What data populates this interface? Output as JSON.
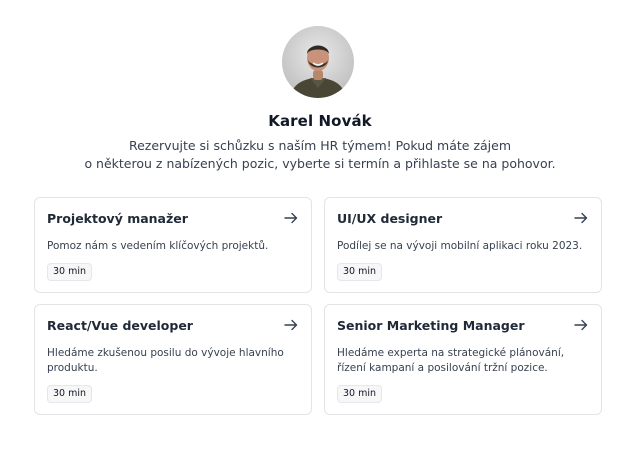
{
  "profile": {
    "name": "Karel Novák",
    "intro_line1": "Rezervujte si schůzku s naším HR týmem! Pokud máte zájem",
    "intro_line2": "o některou z nabízených pozic, vyberte si termín a přihlaste se na pohovor."
  },
  "positions": [
    {
      "title": "Projektový manažer",
      "description": "Pomoz nám s vedením klíčových projektů.",
      "duration": "30 min"
    },
    {
      "title": "UI/UX designer",
      "description": "Podílej se na vývoji mobilní aplikaci roku 2023.",
      "duration": "30 min"
    },
    {
      "title": "React/Vue developer",
      "description": "Hledáme zkušenou posilu do vývoje hlavního produktu.",
      "duration": "30 min"
    },
    {
      "title": "Senior Marketing Manager",
      "description": "Hledáme experta na strategické plánování, řízení kampaní a posilování tržní pozice.",
      "duration": "30 min"
    }
  ],
  "icons": {
    "card_arrow": "arrow-right-icon",
    "avatar": "profile-photo"
  }
}
